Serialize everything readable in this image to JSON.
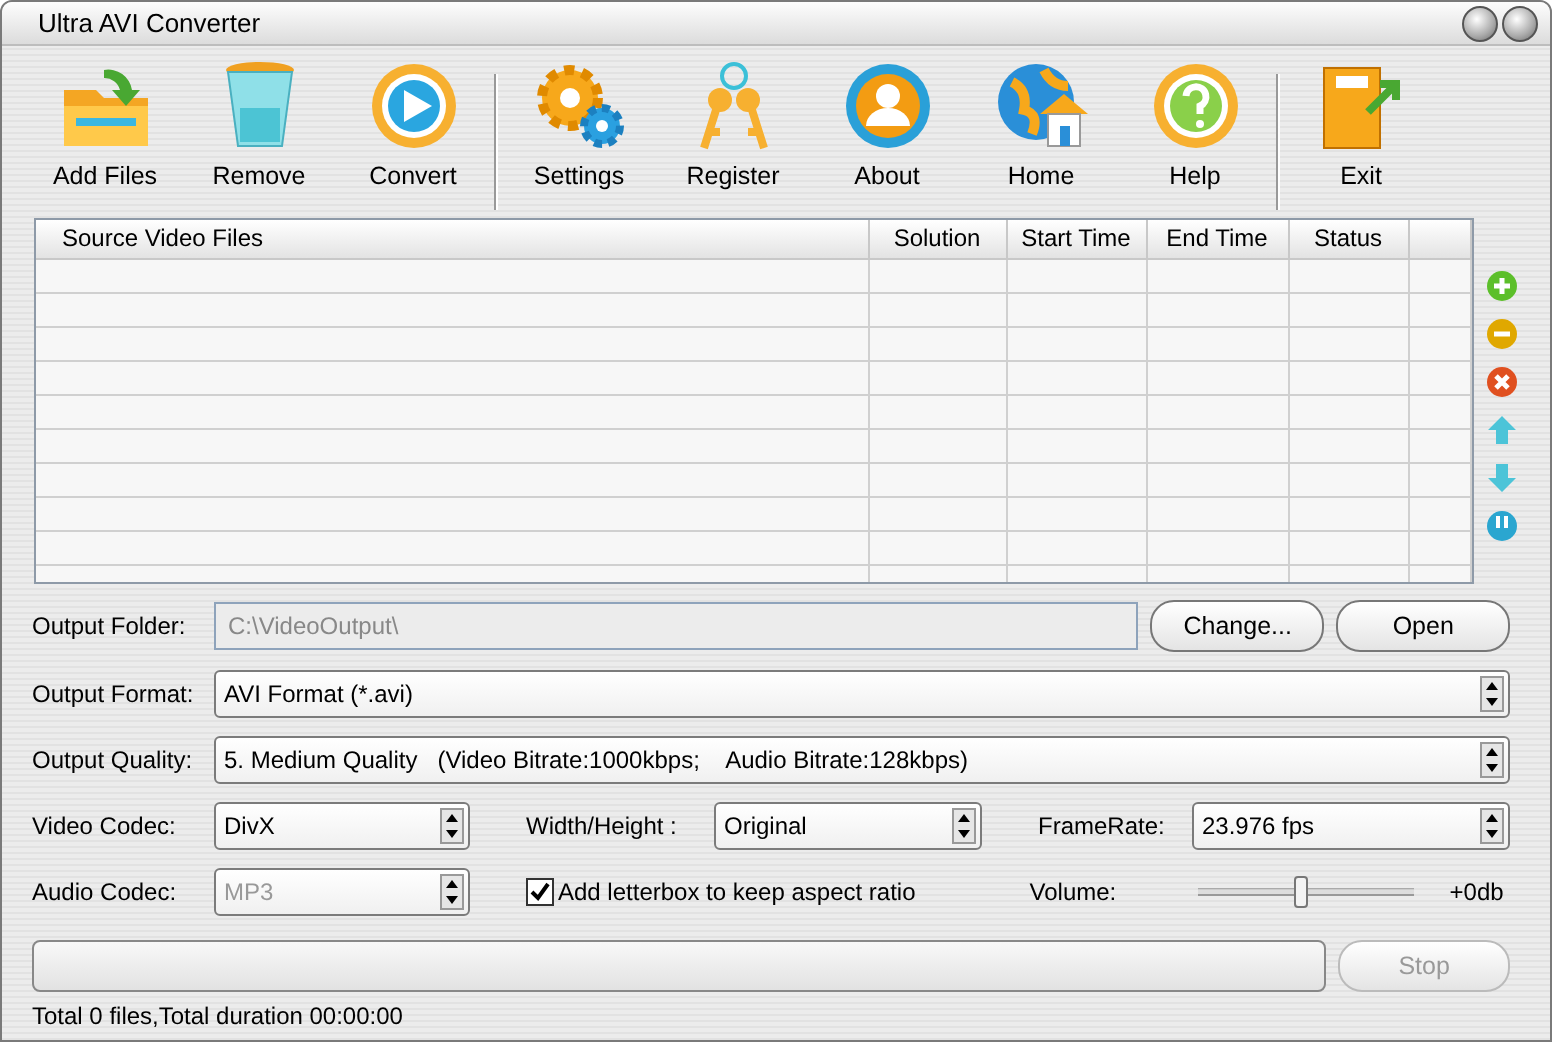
{
  "window": {
    "title": "Ultra AVI Converter"
  },
  "toolbar": {
    "groups": [
      {
        "items": [
          {
            "label": "Add Files"
          },
          {
            "label": "Remove"
          },
          {
            "label": "Convert"
          }
        ]
      },
      {
        "items": [
          {
            "label": "Settings"
          },
          {
            "label": "Register"
          },
          {
            "label": "About"
          },
          {
            "label": "Home"
          },
          {
            "label": "Help"
          }
        ]
      },
      {
        "items": [
          {
            "label": "Exit"
          }
        ]
      }
    ]
  },
  "table": {
    "columns": [
      "Source Video Files",
      "Solution",
      "Start Time",
      "End Time",
      "Status"
    ]
  },
  "output_folder": {
    "label": "Output Folder:",
    "value": "C:\\VideoOutput\\",
    "disabled": true,
    "buttons": [
      "Change...",
      "Open"
    ]
  },
  "output_format": {
    "label": "Output Format:",
    "value": "AVI Format (*.avi)"
  },
  "output_quality": {
    "label": "Output Quality:",
    "value": "5. Medium Quality   (Video Bitrate:1000kbps;    Audio Bitrate:128kbps)"
  },
  "video_codec": {
    "label": "Video Codec:",
    "value": "DivX",
    "disabled": false
  },
  "width_height": {
    "label": "Width/Height :",
    "value": "Original"
  },
  "frame_rate": {
    "label": "FrameRate:",
    "value": "23.976 fps"
  },
  "audio_codec": {
    "label": "Audio Codec:",
    "value": "MP3",
    "disabled": true
  },
  "letterbox": {
    "label": "Add letterbox to keep aspect ratio",
    "checked": true
  },
  "volume": {
    "label": "Volume:",
    "level": 0.47,
    "reading": "+0db"
  },
  "progress": {
    "level": 0
  },
  "stop_button": {
    "label": "Stop",
    "disabled": true
  },
  "status_bar": {
    "text": "Total 0 files,Total duration 00:00:00"
  }
}
